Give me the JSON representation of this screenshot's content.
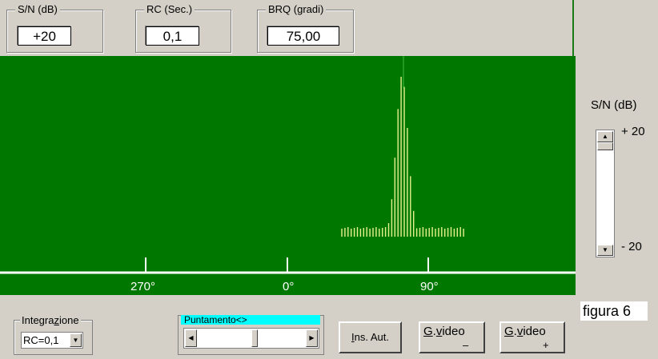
{
  "fields": {
    "sn": {
      "label": "S/N (dB)",
      "value": "+20"
    },
    "rc": {
      "label": "RC (Sec.)",
      "value": "0,1"
    },
    "brq": {
      "label": "BRQ (gradi)",
      "value": "75,00"
    }
  },
  "axis": {
    "labels": [
      "270°",
      "0°",
      "90°"
    ]
  },
  "colors": {
    "scope_bg": "#007800",
    "signal": "#e8f08c",
    "axis": "#ffffff",
    "highlight": "#00ffff"
  },
  "signal_chart": {
    "noise_count": 40,
    "peak_center_index": 24
  },
  "side": {
    "title": "S/N (dB)",
    "top_label": "+ 20",
    "bottom_label": "- 20",
    "slider_position": "top"
  },
  "caption": "figura 6",
  "integrazione": {
    "label_pre": "Integra",
    "label_underline": "z",
    "label_post": "ione",
    "selected": "RC=0,1",
    "dropdown_icon": "triangle-down-icon"
  },
  "puntamento": {
    "label": "Puntamento<>",
    "position": 0.5
  },
  "buttons": {
    "ins_aut": {
      "u": "I",
      "rest": "ns. Aut."
    },
    "gvideo_minus": {
      "u1": "G",
      "mid": ".",
      "u2": "v",
      "rest": "ideo",
      "sign": "–"
    },
    "gvideo_plus": {
      "u1": "G",
      "mid": ".",
      "u2": "v",
      "rest": "ideo",
      "sign": "+"
    }
  }
}
